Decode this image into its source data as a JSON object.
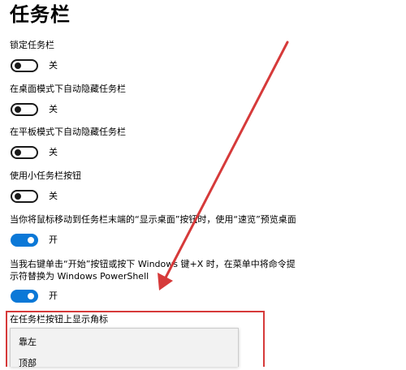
{
  "page": {
    "title": "任务栏"
  },
  "settings": [
    {
      "label": "锁定任务栏",
      "state": "关"
    },
    {
      "label": "在桌面模式下自动隐藏任务栏",
      "state": "关"
    },
    {
      "label": "在平板模式下自动隐藏任务栏",
      "state": "关"
    },
    {
      "label": "使用小任务栏按钮",
      "state": "关"
    },
    {
      "label": "当你将鼠标移动到任务栏末端的“显示桌面”按钮时，使用“速览”预览桌面",
      "state": "开"
    },
    {
      "label_line1": "当我右键单击“开始”按钮或按下 Windows 键+X 时，在菜单中将命令提",
      "label_line2": "示符替换为 Windows PowerShell",
      "state": "开"
    }
  ],
  "taskbar_position": {
    "label": "在任务栏按钮上显示角标",
    "options": [
      "靠左",
      "顶部"
    ]
  },
  "colors": {
    "toggle_on": "#0b78d7",
    "annotation": "#d63a3a"
  }
}
